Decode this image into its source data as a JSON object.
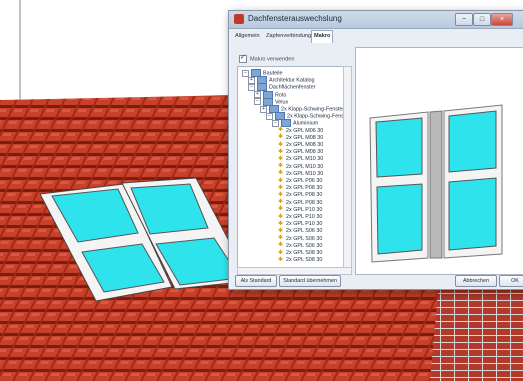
{
  "dialog": {
    "title": "Dachfensterauswechslung",
    "tabs": [
      "Allgemein",
      "Zapfenverbindung",
      "Makro"
    ],
    "active_tab": "Makro",
    "use_macro_label": "Makro verwenden",
    "tree": [
      {
        "label": "Bauteile",
        "depth": 0,
        "expander": "−",
        "icon": "folder"
      },
      {
        "label": "Architektur Katalog",
        "depth": 1,
        "expander": "+",
        "icon": "folder"
      },
      {
        "label": "Dachflächenfenster",
        "depth": 1,
        "expander": "−",
        "icon": "folder"
      },
      {
        "label": "Roto",
        "depth": 2,
        "expander": "+",
        "icon": "folder"
      },
      {
        "label": "Velux",
        "depth": 2,
        "expander": "−",
        "icon": "folder"
      },
      {
        "label": "2x Klapp-Schwing-Fenster",
        "depth": 3,
        "expander": "+",
        "icon": "folder"
      },
      {
        "label": "2x Klapp-Schwing-Fenster",
        "depth": 4,
        "expander": "−",
        "icon": "folder"
      },
      {
        "label": "Aluminium",
        "depth": 5,
        "expander": "−",
        "icon": "folder"
      },
      {
        "label": "2x GPL M06 30",
        "depth": 6,
        "icon": "leaf"
      },
      {
        "label": "2x GPL M08 30",
        "depth": 6,
        "icon": "leaf"
      },
      {
        "label": "2x GPL M08 30",
        "depth": 6,
        "icon": "leaf"
      },
      {
        "label": "2x GPL M08 30",
        "depth": 6,
        "icon": "leaf"
      },
      {
        "label": "2x GPL M10 30",
        "depth": 6,
        "icon": "leaf"
      },
      {
        "label": "2x GPL M10 30",
        "depth": 6,
        "icon": "leaf"
      },
      {
        "label": "2x GPL M10 30",
        "depth": 6,
        "icon": "leaf"
      },
      {
        "label": "2x GPL P06 30",
        "depth": 6,
        "icon": "leaf"
      },
      {
        "label": "2x GPL P08 30",
        "depth": 6,
        "icon": "leaf"
      },
      {
        "label": "2x GPL P08 30",
        "depth": 6,
        "icon": "leaf"
      },
      {
        "label": "2x GPL P08 30",
        "depth": 6,
        "icon": "leaf"
      },
      {
        "label": "2x GPL P10 30",
        "depth": 6,
        "icon": "leaf"
      },
      {
        "label": "2x GPL P10 30",
        "depth": 6,
        "icon": "leaf"
      },
      {
        "label": "2x GPL P10 30",
        "depth": 6,
        "icon": "leaf"
      },
      {
        "label": "2x GPL S06 30",
        "depth": 6,
        "icon": "leaf"
      },
      {
        "label": "2x GPL S06 30",
        "depth": 6,
        "icon": "leaf"
      },
      {
        "label": "2x GPL S06 30",
        "depth": 6,
        "icon": "leaf"
      },
      {
        "label": "2x GPL S08 30",
        "depth": 6,
        "icon": "leaf"
      },
      {
        "label": "2x GPL S08 30",
        "depth": 6,
        "icon": "leaf"
      }
    ],
    "buttons": {
      "as_default": "Als Standard",
      "apply_default": "Standard übernehmen",
      "cancel": "Abbrechen",
      "ok": "OK"
    },
    "window_controls": {
      "minimize": "−",
      "maximize": "□",
      "close": "×"
    }
  },
  "colors": {
    "glass": "#2fe3ec",
    "frame": "#f2f2f2",
    "tile": "#c9402a",
    "tile_shadow": "#7a1d10",
    "sky": "#ffffff"
  }
}
